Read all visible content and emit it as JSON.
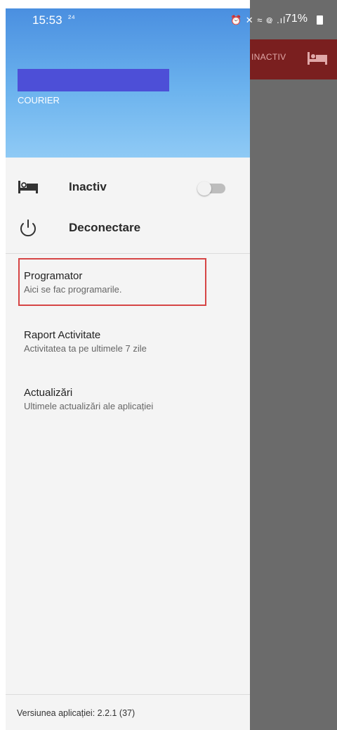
{
  "status_bar": {
    "time": "15:53",
    "notification": "²⁴",
    "icons": "⏰ ✕ ≈ ᪤ .ıl",
    "battery": "71%"
  },
  "background_app": {
    "status_label": "INACTIV",
    "bed_icon": "bed-icon"
  },
  "drawer": {
    "header": {
      "role": "COURIER"
    },
    "menu": [
      {
        "label": "Inactiv",
        "icon": "bed-icon",
        "toggle_on": false
      },
      {
        "label": "Deconectare",
        "icon": "power-icon"
      }
    ],
    "items": [
      {
        "title": "Programator",
        "subtitle": "Aici se fac programarile."
      },
      {
        "title": "Raport Activitate",
        "subtitle": "Activitatea ta pe ultimele 7 zile"
      },
      {
        "title": "Actualizări",
        "subtitle": "Ultimele actualizări ale aplicației"
      }
    ],
    "version": "Versiunea aplicației: 2.2.1 (37)"
  },
  "colors": {
    "header_top": "#4a8fe0",
    "header_bottom": "#8fcaf5",
    "app_bar": "#7a1f1f",
    "highlight": "#d64545"
  }
}
